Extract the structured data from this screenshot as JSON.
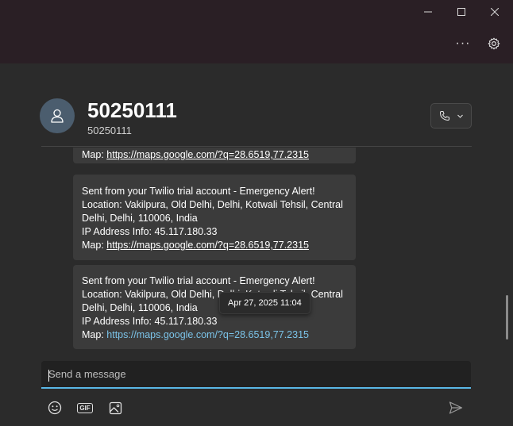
{
  "window": {
    "minimize_icon": "minimize-icon",
    "maximize_icon": "maximize-icon",
    "close_icon": "close-icon",
    "more_label": "···",
    "settings_icon": "gear-icon"
  },
  "contact": {
    "name": "50250111",
    "number": "50250111",
    "avatar_icon": "person-icon",
    "call_icon": "phone-icon"
  },
  "messages": [
    {
      "partial_map_label": "Map:",
      "partial_map_url": "https://maps.google.com/?q=28.6519,77.2315"
    },
    {
      "lines": [
        "Sent from your Twilio trial account - Emergency Alert!",
        "Location: Vakilpura, Old Delhi, Delhi, Kotwali Tehsil, Central",
        "Delhi, Delhi, 110006, India",
        "IP Address Info: 45.117.180.33"
      ],
      "map_label": "Map:",
      "map_url": "https://maps.google.com/?q=28.6519,77.2315"
    },
    {
      "lines": [
        "Sent from your Twilio trial account - Emergency Alert!",
        "Location: Vakilpura, Old Delhi, Delhi, Kotwali Tehsil, Central",
        "Delhi, Delhi, 110006, India",
        "IP Address Info: 45.117.180.33"
      ],
      "map_label": "Map:",
      "map_url": "https://maps.google.com/?q=28.6519,77.2315"
    }
  ],
  "tooltip": "Apr 27, 2025 11:04",
  "compose": {
    "placeholder": "Send a message",
    "value": ""
  },
  "toolbar": {
    "emoji_icon": "emoji-icon",
    "gif_label": "GIF",
    "image_icon": "image-icon",
    "send_icon": "send-icon"
  },
  "colors": {
    "titlebar": "#2a1f25",
    "background": "#2b2b2b",
    "bubble": "#3b3b3b",
    "link_accent": "#7bc3e8",
    "compose_underline": "#5ab7e6"
  }
}
